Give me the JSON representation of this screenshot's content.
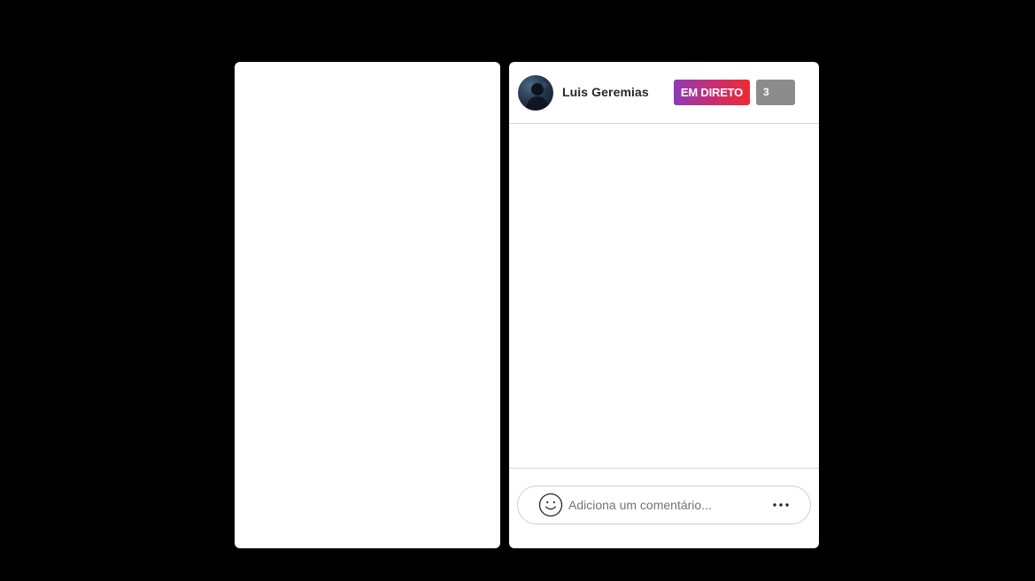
{
  "video_panel": {},
  "live_panel": {
    "header": {
      "avatar_icon": "user-avatar",
      "username": "Luis Geremias",
      "live_badge": "EM DIRETO",
      "viewer_count": "3"
    },
    "comments": [],
    "comment_bar": {
      "emoji_icon": "smiley-face-icon",
      "input_value": "",
      "input_placeholder": "Adiciona um comentário...",
      "more_icon": "more-dots-icon"
    }
  },
  "colors": {
    "background": "#000000",
    "panel": "#ffffff",
    "live_gradient_start": "#8e3bb5",
    "live_gradient_end": "#ee2a32",
    "viewer_badge": "#8c8c8c"
  }
}
